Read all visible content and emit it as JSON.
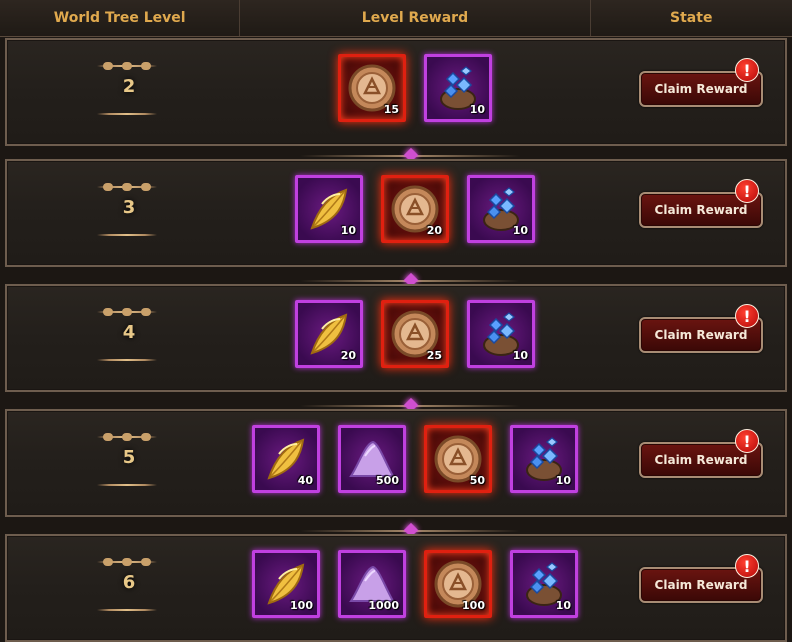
{
  "header": {
    "col_level": "World Tree Level",
    "col_reward": "Level Reward",
    "col_state": "State"
  },
  "rows": [
    {
      "level": "2",
      "claim_label": "Claim Reward",
      "alert": "!",
      "rewards": [
        {
          "icon": "coin-icon",
          "frame": "red",
          "qty": "15"
        },
        {
          "icon": "gem-pouch-icon",
          "frame": "purple",
          "qty": "10"
        }
      ]
    },
    {
      "level": "3",
      "claim_label": "Claim Reward",
      "alert": "!",
      "rewards": [
        {
          "icon": "golden-leaf-icon",
          "frame": "purple",
          "qty": "10"
        },
        {
          "icon": "coin-icon",
          "frame": "red",
          "qty": "20"
        },
        {
          "icon": "gem-pouch-icon",
          "frame": "purple",
          "qty": "10"
        }
      ]
    },
    {
      "level": "4",
      "claim_label": "Claim Reward",
      "alert": "!",
      "rewards": [
        {
          "icon": "golden-leaf-icon",
          "frame": "purple",
          "qty": "20"
        },
        {
          "icon": "coin-icon",
          "frame": "red",
          "qty": "25"
        },
        {
          "icon": "gem-pouch-icon",
          "frame": "purple",
          "qty": "10"
        }
      ]
    },
    {
      "level": "5",
      "claim_label": "Claim Reward",
      "alert": "!",
      "rewards": [
        {
          "icon": "golden-leaf-icon",
          "frame": "purple",
          "qty": "40"
        },
        {
          "icon": "purple-dust-icon",
          "frame": "purple",
          "qty": "500"
        },
        {
          "icon": "coin-icon",
          "frame": "red",
          "qty": "50"
        },
        {
          "icon": "gem-pouch-icon",
          "frame": "purple",
          "qty": "10"
        }
      ]
    },
    {
      "level": "6",
      "claim_label": "Claim Reward",
      "alert": "!",
      "rewards": [
        {
          "icon": "golden-leaf-icon",
          "frame": "purple",
          "qty": "100"
        },
        {
          "icon": "purple-dust-icon",
          "frame": "purple",
          "qty": "1000"
        },
        {
          "icon": "coin-icon",
          "frame": "red",
          "qty": "100"
        },
        {
          "icon": "gem-pouch-icon",
          "frame": "purple",
          "qty": "10"
        }
      ]
    }
  ],
  "colors": {
    "header_text": "#e0a94e",
    "level_text": "#e8c888",
    "red_frame": "#e02010",
    "purple_frame": "#c040e0",
    "button_bg": "#6a1410"
  }
}
